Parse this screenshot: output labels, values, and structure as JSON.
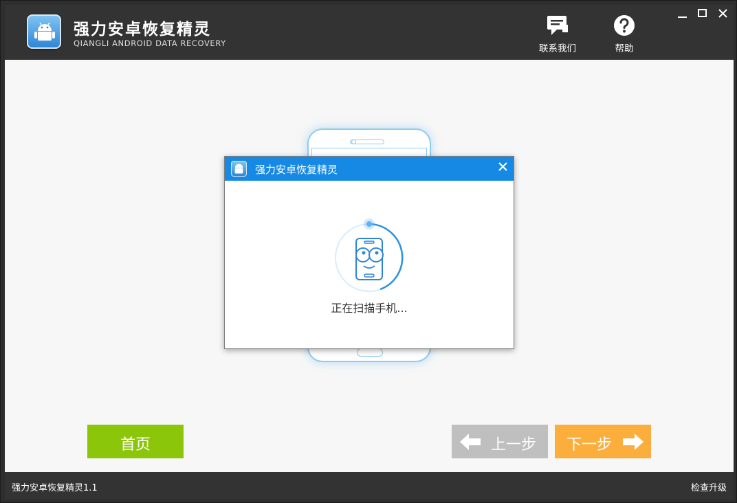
{
  "window": {
    "title": "强力安卓恢复精灵",
    "subtitle": "QIANGLI ANDROID DATA RECOVERY",
    "icons": {
      "minimize": "minimize-icon",
      "maximize": "maximize-icon",
      "close": "close-icon"
    }
  },
  "header": {
    "contact_label": "联系我们",
    "contact_icon": "chat-icon",
    "help_label": "帮助",
    "help_icon": "question-icon"
  },
  "dialog": {
    "title": "强力安卓恢复精灵",
    "status": "正在扫描手机...",
    "close_icon": "close-icon"
  },
  "nav": {
    "home_label": "首页",
    "prev_label": "上一步",
    "next_label": "下一步"
  },
  "footer": {
    "version": "强力安卓恢复精灵1.1",
    "upgrade": "检查升级"
  },
  "colors": {
    "header_bg": "#333333",
    "dialog_titlebar": "#1589e3",
    "home_button": "#8cc60a",
    "prev_button": "#bfbfbf",
    "next_button": "#fbae3c",
    "phone_outline": "#8fcbf0"
  }
}
